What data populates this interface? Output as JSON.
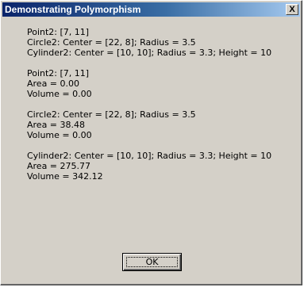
{
  "window": {
    "title": "Demonstrating Polymorphism",
    "close_glyph": "X"
  },
  "message": {
    "groups": [
      {
        "lines": [
          "Point2: [7, 11]",
          "Circle2: Center = [22, 8]; Radius = 3.5",
          "Cylinder2: Center = [10, 10]; Radius = 3.3; Height = 10"
        ]
      },
      {
        "lines": [
          "Point2: [7, 11]",
          "Area = 0.00",
          "Volume = 0.00"
        ]
      },
      {
        "lines": [
          "Circle2: Center = [22, 8]; Radius = 3.5",
          "Area = 38.48",
          "Volume = 0.00"
        ]
      },
      {
        "lines": [
          "Cylinder2: Center = [10, 10]; Radius = 3.3; Height = 10",
          "Area = 275.77",
          "Volume = 342.12"
        ]
      }
    ]
  },
  "buttons": {
    "ok_label": "OK"
  }
}
